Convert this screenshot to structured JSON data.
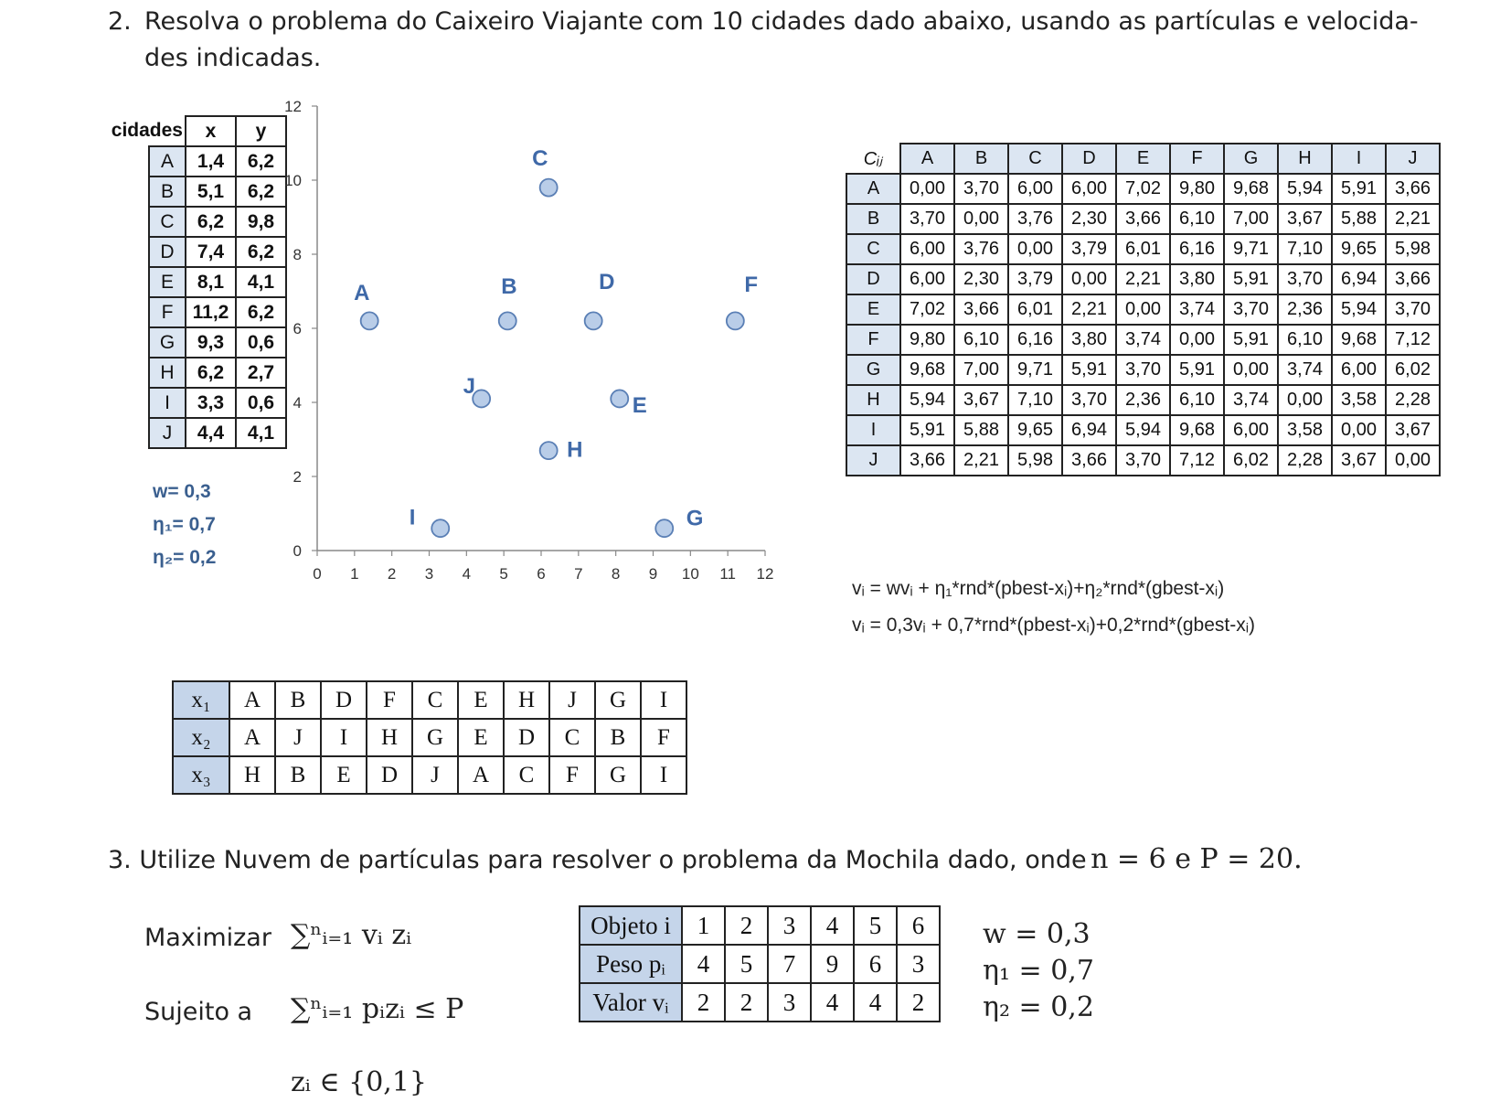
{
  "q2": {
    "number": "2.",
    "line1": "Resolva o problema do Caixeiro Viajante com 10 cidades dado abaixo, usando as partículas e velocida-",
    "line2": "des indicadas."
  },
  "cities_table": {
    "header_label": "cidades",
    "header_x": "x",
    "header_y": "y",
    "rows": [
      {
        "city": "A",
        "x": "1,4",
        "y": "6,2"
      },
      {
        "city": "B",
        "x": "5,1",
        "y": "6,2"
      },
      {
        "city": "C",
        "x": "6,2",
        "y": "9,8"
      },
      {
        "city": "D",
        "x": "7,4",
        "y": "6,2"
      },
      {
        "city": "E",
        "x": "8,1",
        "y": "4,1"
      },
      {
        "city": "F",
        "x": "11,2",
        "y": "6,2"
      },
      {
        "city": "G",
        "x": "9,3",
        "y": "0,6"
      },
      {
        "city": "H",
        "x": "6,2",
        "y": "2,7"
      },
      {
        "city": "I",
        "x": "3,3",
        "y": "0,6"
      },
      {
        "city": "J",
        "x": "4,4",
        "y": "4,1"
      }
    ]
  },
  "params_left": {
    "w": "w= 0,3",
    "eta1": "η₁= 0,7",
    "eta2": "η₂= 0,2"
  },
  "chart_data": {
    "type": "scatter",
    "xlim": [
      0,
      12
    ],
    "ylim": [
      0,
      12
    ],
    "x_ticks": [
      "0",
      "1",
      "2",
      "3",
      "4",
      "5",
      "6",
      "7",
      "8",
      "9",
      "10",
      "11",
      "12"
    ],
    "y_ticks": [
      "0",
      "2",
      "4",
      "6",
      "8",
      "10",
      "12"
    ],
    "grid": false,
    "points": [
      {
        "label": "A",
        "x": 1.4,
        "y": 6.2
      },
      {
        "label": "B",
        "x": 5.1,
        "y": 6.2
      },
      {
        "label": "C",
        "x": 6.2,
        "y": 9.8
      },
      {
        "label": "D",
        "x": 7.4,
        "y": 6.2
      },
      {
        "label": "E",
        "x": 8.1,
        "y": 4.1
      },
      {
        "label": "F",
        "x": 11.2,
        "y": 6.2
      },
      {
        "label": "G",
        "x": 9.3,
        "y": 0.6
      },
      {
        "label": "H",
        "x": 6.2,
        "y": 2.7
      },
      {
        "label": "I",
        "x": 3.3,
        "y": 0.6
      },
      {
        "label": "J",
        "x": 4.4,
        "y": 4.1
      }
    ],
    "marker_fill": "#b9cde8",
    "marker_stroke": "#5a7fb5",
    "label_color": "#3f69a8"
  },
  "cij": {
    "corner": "Cᵢⱼ",
    "headers": [
      "A",
      "B",
      "C",
      "D",
      "E",
      "F",
      "G",
      "H",
      "I",
      "J"
    ],
    "rows": [
      {
        "label": "A",
        "values": [
          "0,00",
          "3,70",
          "6,00",
          "6,00",
          "7,02",
          "9,80",
          "9,68",
          "5,94",
          "5,91",
          "3,66"
        ]
      },
      {
        "label": "B",
        "values": [
          "3,70",
          "0,00",
          "3,76",
          "2,30",
          "3,66",
          "6,10",
          "7,00",
          "3,67",
          "5,88",
          "2,21"
        ]
      },
      {
        "label": "C",
        "values": [
          "6,00",
          "3,76",
          "0,00",
          "3,79",
          "6,01",
          "6,16",
          "9,71",
          "7,10",
          "9,65",
          "5,98"
        ]
      },
      {
        "label": "D",
        "values": [
          "6,00",
          "2,30",
          "3,79",
          "0,00",
          "2,21",
          "3,80",
          "5,91",
          "3,70",
          "6,94",
          "3,66"
        ]
      },
      {
        "label": "E",
        "values": [
          "7,02",
          "3,66",
          "6,01",
          "2,21",
          "0,00",
          "3,74",
          "3,70",
          "2,36",
          "5,94",
          "3,70"
        ]
      },
      {
        "label": "F",
        "values": [
          "9,80",
          "6,10",
          "6,16",
          "3,80",
          "3,74",
          "0,00",
          "5,91",
          "6,10",
          "9,68",
          "7,12"
        ]
      },
      {
        "label": "G",
        "values": [
          "9,68",
          "7,00",
          "9,71",
          "5,91",
          "3,70",
          "5,91",
          "0,00",
          "3,74",
          "6,00",
          "6,02"
        ]
      },
      {
        "label": "H",
        "values": [
          "5,94",
          "3,67",
          "7,10",
          "3,70",
          "2,36",
          "6,10",
          "3,74",
          "0,00",
          "3,58",
          "2,28"
        ]
      },
      {
        "label": "I",
        "values": [
          "5,91",
          "5,88",
          "9,65",
          "6,94",
          "5,94",
          "9,68",
          "6,00",
          "3,58",
          "0,00",
          "3,67"
        ]
      },
      {
        "label": "J",
        "values": [
          "3,66",
          "2,21",
          "5,98",
          "3,66",
          "3,70",
          "7,12",
          "6,02",
          "2,28",
          "3,67",
          "0,00"
        ]
      }
    ]
  },
  "formulas": {
    "line1": "vᵢ = wvᵢ + η₁*rnd*(pbest-xᵢ)+η₂*rnd*(gbest-xᵢ)",
    "line2": "vᵢ = 0,3vᵢ + 0,7*rnd*(pbest-xᵢ)+0,2*rnd*(gbest-xᵢ)"
  },
  "particles": [
    {
      "label": "x₁",
      "values": [
        "A",
        "B",
        "D",
        "F",
        "C",
        "E",
        "H",
        "J",
        "G",
        "I"
      ]
    },
    {
      "label": "x₂",
      "values": [
        "A",
        "J",
        "I",
        "H",
        "G",
        "E",
        "D",
        "C",
        "B",
        "F"
      ]
    },
    {
      "label": "x₃",
      "values": [
        "H",
        "B",
        "E",
        "D",
        "J",
        "A",
        "C",
        "F",
        "G",
        "I"
      ]
    }
  ],
  "q3": {
    "text": "3. Utilize Nuvem de partículas para resolver o problema da Mochila dado, onde",
    "math": "n = 6 e P = 20."
  },
  "knapsack_formulation": {
    "maximize_label": "Maximizar",
    "maximize_expr": "∑ⁿᵢ₌₁ vᵢ zᵢ",
    "subject_label": "Sujeito a",
    "subject_expr": "∑ⁿᵢ₌₁ pᵢzᵢ ≤ P",
    "domain_expr": "zᵢ ∈ {0,1}"
  },
  "knapsack_table": [
    {
      "label": "Objeto i",
      "values": [
        "1",
        "2",
        "3",
        "4",
        "5",
        "6"
      ]
    },
    {
      "label": "Peso pᵢ",
      "values": [
        "4",
        "5",
        "7",
        "9",
        "6",
        "3"
      ]
    },
    {
      "label": "Valor vᵢ",
      "values": [
        "2",
        "2",
        "3",
        "4",
        "4",
        "2"
      ]
    }
  ],
  "params_right": {
    "w": "w = 0,3",
    "eta1": "η₁ = 0,7",
    "eta2": "η₂ = 0,2"
  }
}
